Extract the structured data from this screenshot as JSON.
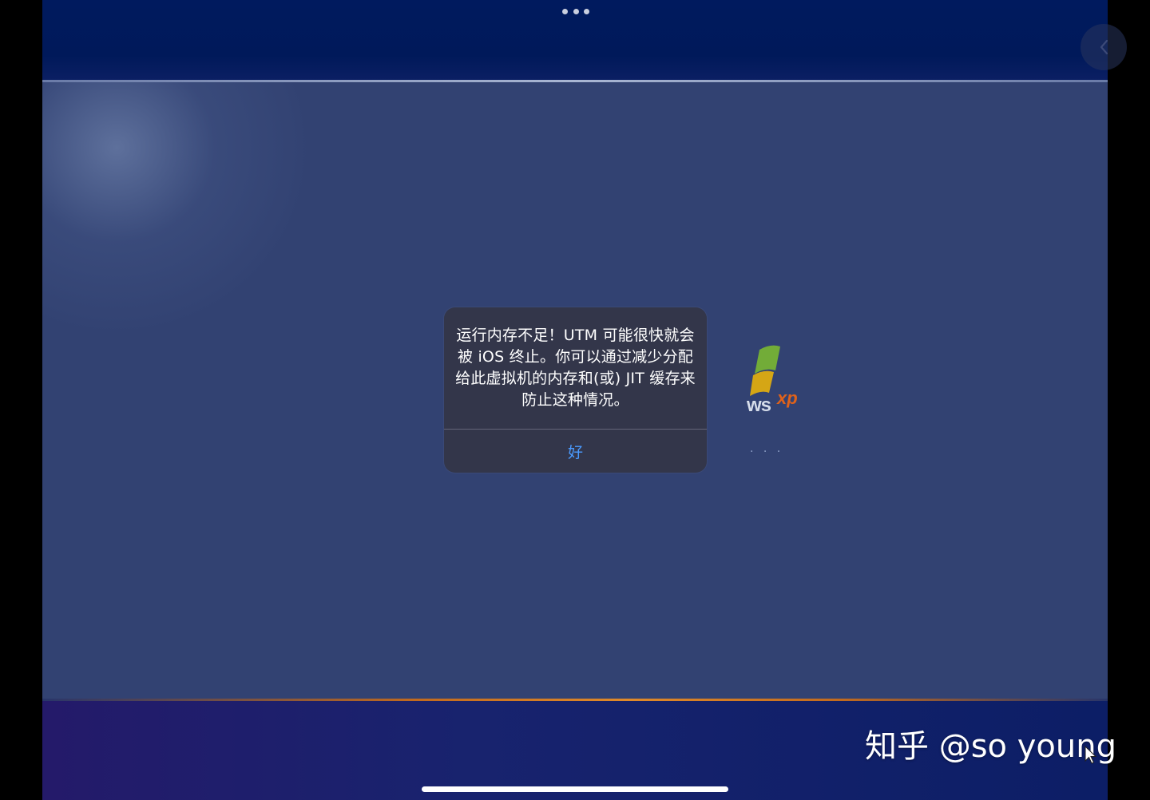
{
  "toolbar": {
    "more_icon": "ellipsis-icon",
    "back_icon": "chevron-left-icon"
  },
  "vm_screen": {
    "boot_logo": {
      "wordmark": "ws",
      "suffix": "xp",
      "progress_dots": "· · ·"
    }
  },
  "alert": {
    "message": "运行内存不足！UTM 可能很快就会被 iOS 终止。你可以通过减少分配给此虚拟机的内存和(或) JIT 缓存来防止这种情况。",
    "ok_label": "好",
    "ok_color": "#4a9bff"
  },
  "watermark": {
    "text": "知乎 @so young"
  },
  "colors": {
    "xp_blue_band": "#001a5e",
    "xp_middle": "#324272",
    "xp_orange_line": "#e08a2a",
    "alert_bg": "#343648"
  }
}
